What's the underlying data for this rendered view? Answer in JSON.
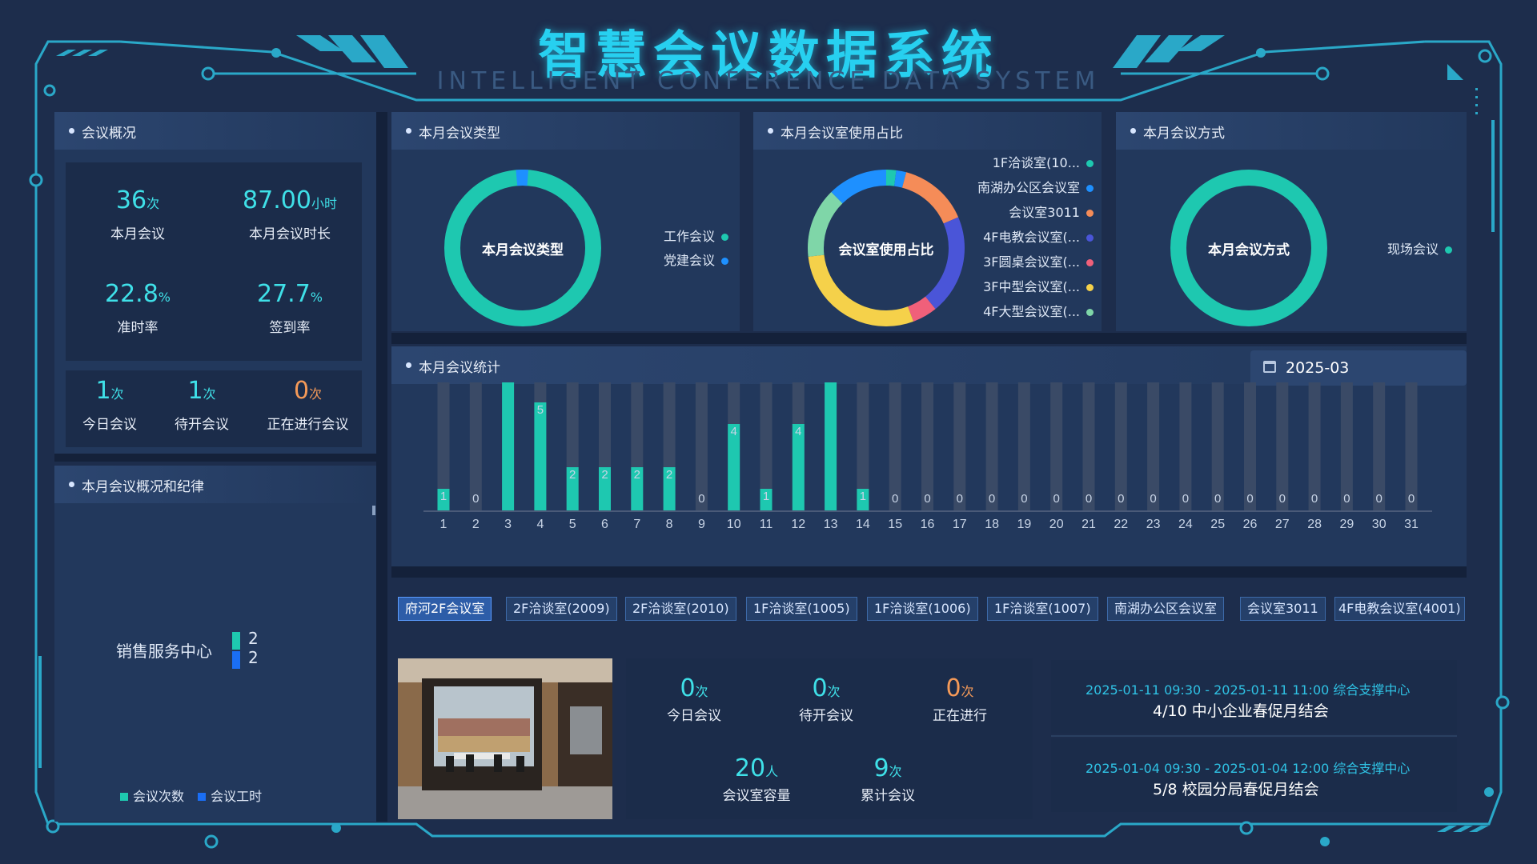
{
  "header": {
    "title": "智慧会议数据系统",
    "subtitle": "INTELLIGENT CONFERENCE DATA SYSTEM"
  },
  "overview": {
    "title": "会议概况",
    "month_meetings": {
      "value": "36",
      "unit": "次",
      "label": "本月会议"
    },
    "month_hours": {
      "value": "87.00",
      "unit": "小时",
      "label": "本月会议时长"
    },
    "punctuality": {
      "value": "22.8",
      "unit": "%",
      "label": "准时率"
    },
    "signin": {
      "value": "27.7",
      "unit": "%",
      "label": "签到率"
    },
    "today": {
      "value": "1",
      "unit": "次",
      "label": "今日会议"
    },
    "pending": {
      "value": "1",
      "unit": "次",
      "label": "待开会议"
    },
    "ongoing": {
      "value": "0",
      "unit": "次",
      "label": "正在进行会议"
    }
  },
  "discipline": {
    "title": "本月会议概况和纪律",
    "category": "销售服务中心",
    "count_value": "2",
    "hours_value": "2",
    "legend": [
      "会议次数",
      "会议工时"
    ],
    "colors": [
      "#1ec8b0",
      "#1a6ef5"
    ]
  },
  "meeting_type": {
    "title": "本月会议类型",
    "center": "本月会议类型",
    "legend": [
      {
        "name": "工作会议",
        "color": "#1ec8b0"
      },
      {
        "name": "党建会议",
        "color": "#1e90ff"
      }
    ],
    "values": [
      96,
      4
    ]
  },
  "room_usage": {
    "title": "本月会议室使用占比",
    "center": "会议室使用占比",
    "legend": [
      {
        "name": "1F洽谈室(10...",
        "color": "#1ec8b0"
      },
      {
        "name": "南湖办公区会议室",
        "color": "#1e90ff"
      },
      {
        "name": "会议室3011",
        "color": "#f58c58"
      },
      {
        "name": "4F电教会议室(...",
        "color": "#4a55d8"
      },
      {
        "name": "3F圆桌会议室(...",
        "color": "#f0607a"
      },
      {
        "name": "3F中型会议室(...",
        "color": "#f5d14a"
      },
      {
        "name": "4F大型会议室(...",
        "color": "#7fd6a8"
      }
    ],
    "segments": [
      {
        "color": "#1ec8b0",
        "value": 2
      },
      {
        "color": "#1e90ff",
        "value": 2
      },
      {
        "color": "#f58c58",
        "value": 14
      },
      {
        "color": "#4a55d8",
        "value": 20
      },
      {
        "color": "#f0607a",
        "value": 5
      },
      {
        "color": "#f5d14a",
        "value": 28
      },
      {
        "color": "#7fd6a8",
        "value": 14
      },
      {
        "color": "#1e90ff",
        "value": 12
      }
    ]
  },
  "meeting_mode": {
    "title": "本月会议方式",
    "center": "本月会议方式",
    "legend": [
      {
        "name": "现场会议",
        "color": "#1ec8b0"
      }
    ]
  },
  "stats": {
    "title": "本月会议统计",
    "date": "2025-03"
  },
  "chart_data": {
    "type": "bar",
    "categories": [
      "1",
      "2",
      "3",
      "4",
      "5",
      "6",
      "7",
      "8",
      "9",
      "10",
      "11",
      "12",
      "13",
      "14",
      "15",
      "16",
      "17",
      "18",
      "19",
      "20",
      "21",
      "22",
      "23",
      "24",
      "25",
      "26",
      "27",
      "28",
      "29",
      "30",
      "31"
    ],
    "values": [
      1,
      0,
      6,
      5,
      2,
      2,
      2,
      2,
      0,
      4,
      1,
      4,
      6,
      1,
      0,
      0,
      0,
      0,
      0,
      0,
      0,
      0,
      0,
      0,
      0,
      0,
      0,
      0,
      0,
      0,
      0
    ],
    "ylim": [
      0,
      6
    ],
    "color": "#1ec8b0",
    "track_color": "#3a4a66"
  },
  "rooms": {
    "tabs": [
      "府河2F会议室",
      "2F洽谈室(2009)",
      "2F洽谈室(2010)",
      "1F洽谈室(1005)",
      "1F洽谈室(1006)",
      "1F洽谈室(1007)",
      "南湖办公区会议室",
      "会议室3011",
      "4F电教会议室(4001)"
    ],
    "today": {
      "value": "0",
      "unit": "次",
      "label": "今日会议"
    },
    "pending": {
      "value": "0",
      "unit": "次",
      "label": "待开会议"
    },
    "ongoing": {
      "value": "0",
      "unit": "次",
      "label": "正在进行"
    },
    "capacity": {
      "value": "20",
      "unit": "人",
      "label": "会议室容量"
    },
    "total": {
      "value": "9",
      "unit": "次",
      "label": "累计会议"
    },
    "schedule": [
      {
        "when": "2025-01-11 09:30 - 2025-01-11 11:00 综合支撑中心",
        "what": "4/10 中小企业春促月结会"
      },
      {
        "when": "2025-01-04 09:30 - 2025-01-04 12:00 综合支撑中心",
        "what": "5/8 校园分局春促月结会"
      }
    ]
  }
}
